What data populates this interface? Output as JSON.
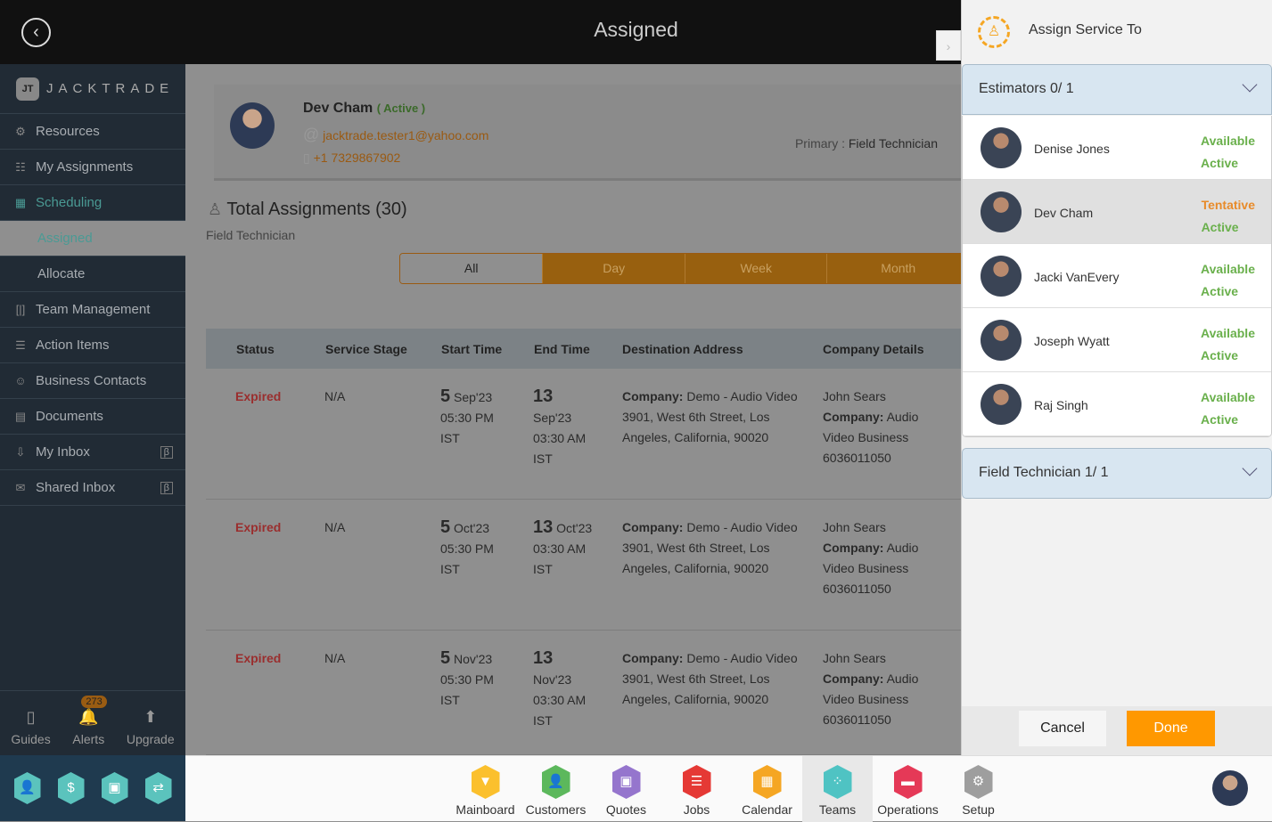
{
  "header": {
    "title": "Assigned"
  },
  "brand": "JACKTRADE",
  "sidebar": {
    "items": [
      {
        "label": "Resources",
        "icon": "resources-icon",
        "glyph": "⚙"
      },
      {
        "label": "My Assignments",
        "icon": "assignments-icon",
        "glyph": "☷"
      },
      {
        "label": "Scheduling",
        "icon": "calendar-icon",
        "glyph": "▦",
        "active": true
      },
      {
        "label": "Assigned",
        "sub": true,
        "selected": true
      },
      {
        "label": "Allocate",
        "sub": true
      },
      {
        "label": "Team Management",
        "icon": "team-icon",
        "glyph": "[|]"
      },
      {
        "label": "Action Items",
        "icon": "clipboard-icon",
        "glyph": "☰"
      },
      {
        "label": "Business Contacts",
        "icon": "contacts-icon",
        "glyph": "☺"
      },
      {
        "label": "Documents",
        "icon": "document-icon",
        "glyph": "▤"
      },
      {
        "label": "My Inbox",
        "icon": "inbox-icon",
        "glyph": "⇩",
        "beta": "β"
      },
      {
        "label": "Shared Inbox",
        "icon": "mail-icon",
        "glyph": "✉",
        "beta": "β"
      }
    ],
    "footer": [
      {
        "label": "Guides",
        "glyph": "▯"
      },
      {
        "label": "Alerts",
        "glyph": "🔔",
        "badge": "273"
      },
      {
        "label": "Upgrade",
        "glyph": "⬆"
      }
    ],
    "quick_icons": [
      {
        "name": "user-icon",
        "glyph": "👤"
      },
      {
        "name": "dollar-icon",
        "glyph": "$"
      },
      {
        "name": "money-icon",
        "glyph": "▣"
      },
      {
        "name": "workflow-icon",
        "glyph": "⇄"
      }
    ]
  },
  "profile": {
    "name": "Dev Cham",
    "status": "( Active )",
    "email": "jacktrade.tester1@yahoo.com",
    "phone": "+1 7329867902",
    "primary_label": "Primary :",
    "primary_value": "Field Technician"
  },
  "total": "Total Assignments (30)",
  "role": "Field Technician",
  "tabs": [
    "All",
    "Day",
    "Week",
    "Month"
  ],
  "table": {
    "headers": [
      "Status",
      "Service Stage",
      "Start Time",
      "End Time",
      "Destination Address",
      "Company Details"
    ],
    "rows": [
      {
        "status": "Expired",
        "stage": "N/A",
        "start_day": "5",
        "start_month": "Sep'23",
        "start_time": "05:30 PM",
        "start_tz": "IST",
        "end_day": "13",
        "end_month": "Sep'23",
        "end_time": "03:30 AM",
        "end_tz": "IST",
        "addr_label": "Company:",
        "addr_company": "Demo - Audio Video",
        "addr": "3901, West 6th Street, Los Angeles, California, 90020",
        "contact": "John Sears",
        "co_label": "Company:",
        "co_name": "Audio Video Business",
        "co_phone": "6036011050"
      },
      {
        "status": "Expired",
        "stage": "N/A",
        "start_day": "5",
        "start_month": "Oct'23",
        "start_time": "05:30 PM",
        "start_tz": "IST",
        "end_day": "13",
        "end_month": "Oct'23",
        "end_time": "03:30 AM",
        "end_tz": "IST",
        "addr_label": "Company:",
        "addr_company": "Demo - Audio Video",
        "addr": "3901, West 6th Street, Los Angeles, California, 90020",
        "contact": "John Sears",
        "co_label": "Company:",
        "co_name": "Audio Video Business",
        "co_phone": "6036011050"
      },
      {
        "status": "Expired",
        "stage": "N/A",
        "start_day": "5",
        "start_month": "Nov'23",
        "start_time": "05:30 PM",
        "start_tz": "IST",
        "end_day": "13",
        "end_month": "Nov'23",
        "end_time": "03:30 AM",
        "end_tz": "IST",
        "addr_label": "Company:",
        "addr_company": "Demo - Audio Video",
        "addr": "3901, West 6th Street, Los Angeles, California, 90020",
        "contact": "John Sears",
        "co_label": "Company:",
        "co_name": "Audio Video Business",
        "co_phone": "6036011050"
      }
    ]
  },
  "panel": {
    "title": "Assign Service To",
    "estimators": "Estimators 0/ 1",
    "field_tech": "Field Technician 1/ 1",
    "people": [
      {
        "name": "Denise Jones",
        "availability": "Available",
        "status": "Active"
      },
      {
        "name": "Dev Cham",
        "availability": "Tentative",
        "status": "Active",
        "selected": true
      },
      {
        "name": "Jacki VanEvery",
        "availability": "Available",
        "status": "Active"
      },
      {
        "name": "Joseph Wyatt",
        "availability": "Available",
        "status": "Active"
      },
      {
        "name": "Raj Singh",
        "availability": "Available",
        "status": "Active"
      }
    ],
    "cancel": "Cancel",
    "done": "Done"
  },
  "bottom_nav": [
    {
      "label": "Mainboard",
      "color": "#fbc02d",
      "glyph": "▼"
    },
    {
      "label": "Customers",
      "color": "#5cb85c",
      "glyph": "👤"
    },
    {
      "label": "Quotes",
      "color": "#9575cd",
      "glyph": "▣"
    },
    {
      "label": "Jobs",
      "color": "#e53935",
      "glyph": "☰"
    },
    {
      "label": "Calendar",
      "color": "#f5a623",
      "glyph": "▦"
    },
    {
      "label": "Teams",
      "color": "#4fc3c3",
      "glyph": "⁘",
      "active": true
    },
    {
      "label": "Operations",
      "color": "#e53957",
      "glyph": "▬"
    },
    {
      "label": "Setup",
      "color": "#9e9e9e",
      "glyph": "⚙"
    }
  ]
}
